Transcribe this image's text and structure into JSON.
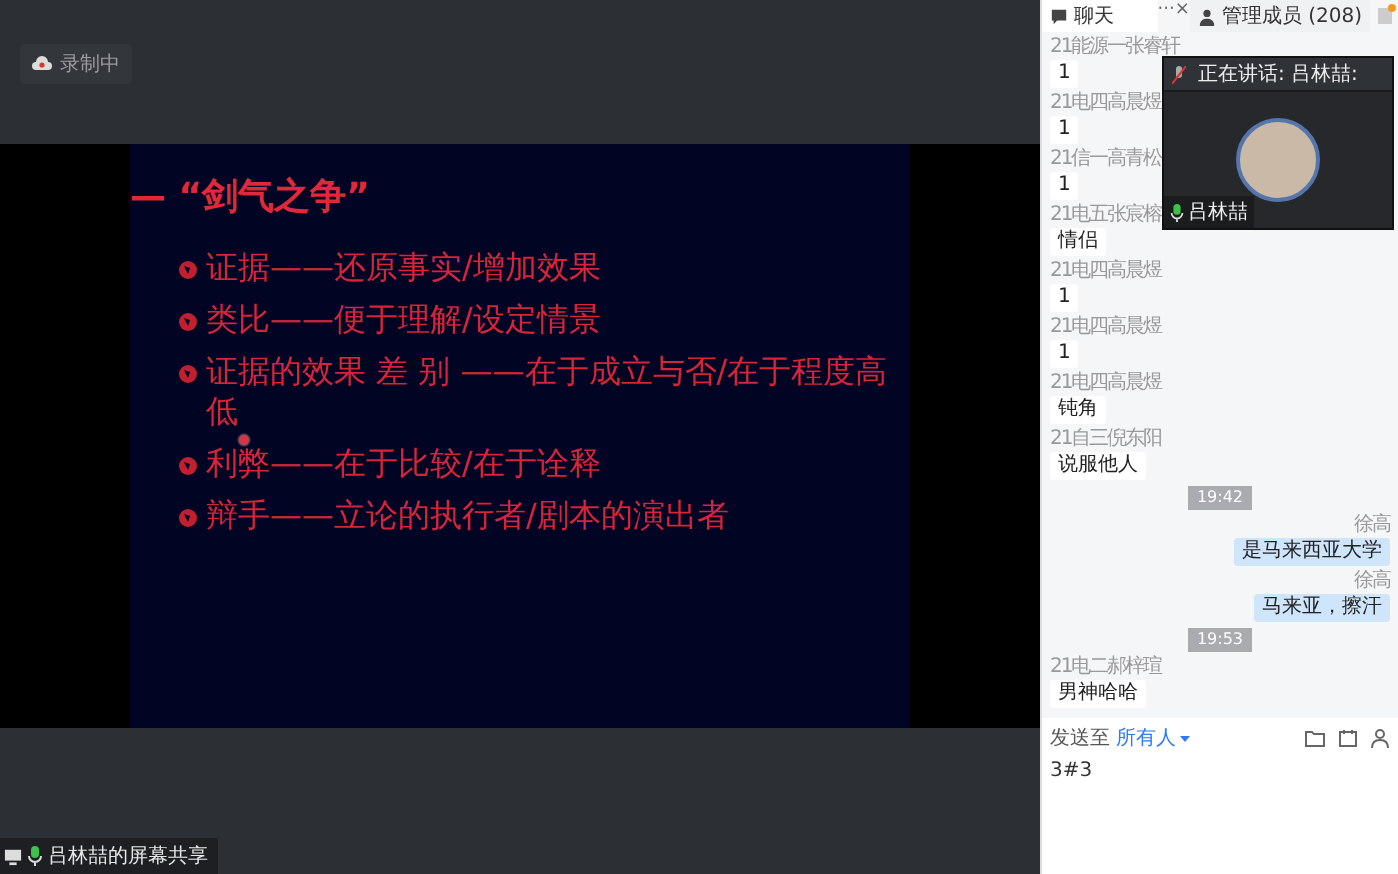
{
  "recording_badge": {
    "label": "录制中"
  },
  "slide": {
    "title": "— “剑气之争”",
    "bullets": [
      "证据——还原事实/增加效果",
      "类比——便于理解/设定情景",
      "证据的效果 差 别 ——在于成立与否/在于程度高低",
      "利弊——在于比较/在于诠释",
      "辩手——立论的执行者/剧本的演出者"
    ]
  },
  "share_label": {
    "label": "吕林喆的屏幕共享"
  },
  "chat_panel": {
    "tabs": [
      {
        "kind": "chat",
        "label": "聊天",
        "selected": true
      },
      {
        "kind": "members",
        "label": "管理成员 (208)",
        "selected": false
      }
    ],
    "tab_more": "···",
    "tab_close": "×",
    "messages": [
      {
        "kind": "other",
        "sender": "21能源一张睿轩",
        "text": "1"
      },
      {
        "kind": "other",
        "sender": "21电四高晨煜",
        "text": "1"
      },
      {
        "kind": "other",
        "sender": "21信一高青松",
        "text": "1"
      },
      {
        "kind": "other",
        "sender": "21电五张宸榕",
        "text": "情侣"
      },
      {
        "kind": "other",
        "sender": "21电四高晨煜",
        "text": "1"
      },
      {
        "kind": "other",
        "sender": "21电四高晨煜",
        "text": "1"
      },
      {
        "kind": "other",
        "sender": "21电四高晨煜",
        "text": "钝角"
      },
      {
        "kind": "other",
        "sender": "21自三倪东阳",
        "text": "说服他人"
      },
      {
        "kind": "time",
        "text": "19:42"
      },
      {
        "kind": "self",
        "sender": "徐高",
        "text": "是马来西亚大学"
      },
      {
        "kind": "self",
        "sender": "徐高",
        "text": "马来亚，擦汗"
      },
      {
        "kind": "time",
        "text": "19:53"
      },
      {
        "kind": "other",
        "sender": "21电二郝梓瑄",
        "text": "男神哈哈"
      }
    ],
    "speaker_overlay": {
      "status": "正在讲话: 吕林喆:",
      "name": "吕林喆"
    },
    "composer": {
      "send_to_label": "发送至",
      "recipient": "所有人",
      "value": "3#3"
    }
  }
}
